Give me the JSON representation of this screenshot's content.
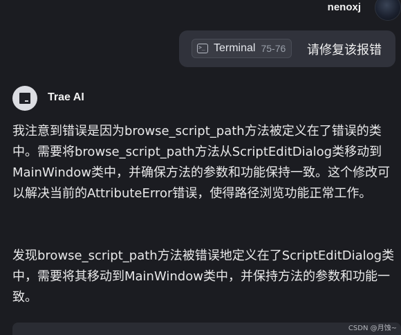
{
  "user": {
    "name": "nenoxj"
  },
  "user_message": {
    "context_chip": {
      "label": "Terminal",
      "range": "75-76",
      "icon": "terminal-icon"
    },
    "text": "请修复该报错"
  },
  "assistant": {
    "name": "Trae AI",
    "paragraphs": [
      "我注意到错误是因为browse_script_path方法被定义在了错误的类中。需要将browse_script_path方法从ScriptEditDialog类移动到MainWindow类中，并确保方法的参数和功能保持一致。这个修改可以解决当前的AttributeError错误，使得路径浏览功能正常工作。",
      "发现browse_script_path方法被错误地定义在了ScriptEditDialog类中，需要将其移动到MainWindow类中，并保持方法的参数和功能一致。"
    ]
  },
  "watermark": "CSDN @月蚀~",
  "colors": {
    "background": "#1b1c21",
    "bubble": "#30323b",
    "chip": "#3a3c45",
    "text": "#e9e9ea"
  }
}
